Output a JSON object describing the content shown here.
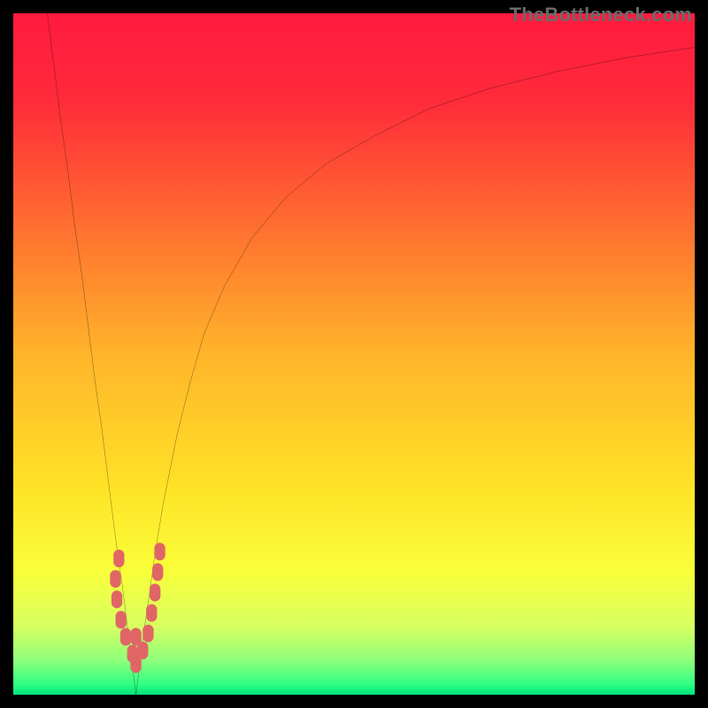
{
  "watermark": "TheBottleneck.com",
  "chart_data": {
    "type": "line",
    "title": "",
    "xlabel": "",
    "ylabel": "",
    "xlim": [
      0,
      100
    ],
    "ylim": [
      0,
      100
    ],
    "grid": false,
    "legend": false,
    "notch_x": 18,
    "background_gradient": [
      {
        "stop": 0.0,
        "color": "#ff1a3f"
      },
      {
        "stop": 0.13,
        "color": "#ff2b3a"
      },
      {
        "stop": 0.3,
        "color": "#ff6a30"
      },
      {
        "stop": 0.5,
        "color": "#ffb42a"
      },
      {
        "stop": 0.7,
        "color": "#ffe327"
      },
      {
        "stop": 0.82,
        "color": "#f9ff3a"
      },
      {
        "stop": 0.9,
        "color": "#d7ff61"
      },
      {
        "stop": 0.95,
        "color": "#8dff7a"
      },
      {
        "stop": 0.985,
        "color": "#2fff83"
      },
      {
        "stop": 1.0,
        "color": "#00e07a"
      }
    ],
    "series": [
      {
        "name": "left-branch",
        "color": "#000000",
        "x": [
          5,
          6,
          7,
          8,
          9,
          10,
          11,
          12,
          13,
          14,
          15,
          16,
          17,
          18
        ],
        "y": [
          100,
          92,
          84,
          77,
          69,
          62,
          54,
          46,
          39,
          31,
          23,
          16,
          8,
          0
        ]
      },
      {
        "name": "right-branch",
        "color": "#000000",
        "x": [
          18,
          19,
          20,
          21,
          22,
          24,
          26,
          28,
          31,
          35,
          40,
          46,
          53,
          61,
          70,
          80,
          90,
          100
        ],
        "y": [
          0,
          8,
          15,
          22,
          28,
          38,
          46,
          53,
          60,
          67,
          73,
          78,
          82,
          86,
          89,
          91.5,
          93.5,
          95
        ]
      }
    ],
    "markers": {
      "name": "notch-cluster",
      "color": "#e06666",
      "points": [
        {
          "x": 15.5,
          "y": 20
        },
        {
          "x": 15.0,
          "y": 17
        },
        {
          "x": 15.2,
          "y": 14
        },
        {
          "x": 15.8,
          "y": 11
        },
        {
          "x": 16.5,
          "y": 8.5
        },
        {
          "x": 17.5,
          "y": 6
        },
        {
          "x": 18.0,
          "y": 4.5
        },
        {
          "x": 19.0,
          "y": 6.5
        },
        {
          "x": 19.8,
          "y": 9
        },
        {
          "x": 20.3,
          "y": 12
        },
        {
          "x": 20.8,
          "y": 15
        },
        {
          "x": 21.2,
          "y": 18
        },
        {
          "x": 21.5,
          "y": 21
        },
        {
          "x": 18.0,
          "y": 8.5
        }
      ]
    }
  }
}
